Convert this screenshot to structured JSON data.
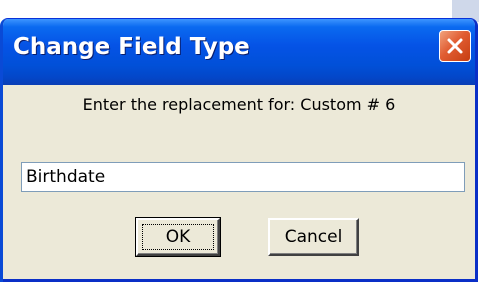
{
  "dialog": {
    "title": "Change Field Type",
    "close_icon": "close-x-icon",
    "prompt": "Enter the replacement for: Custom # 6",
    "input_value": "Birthdate",
    "ok_label": "OK",
    "cancel_label": "Cancel"
  },
  "colors": {
    "titlebar": "#0553e6",
    "face": "#ece9d8",
    "close_button": "#e15d32"
  }
}
